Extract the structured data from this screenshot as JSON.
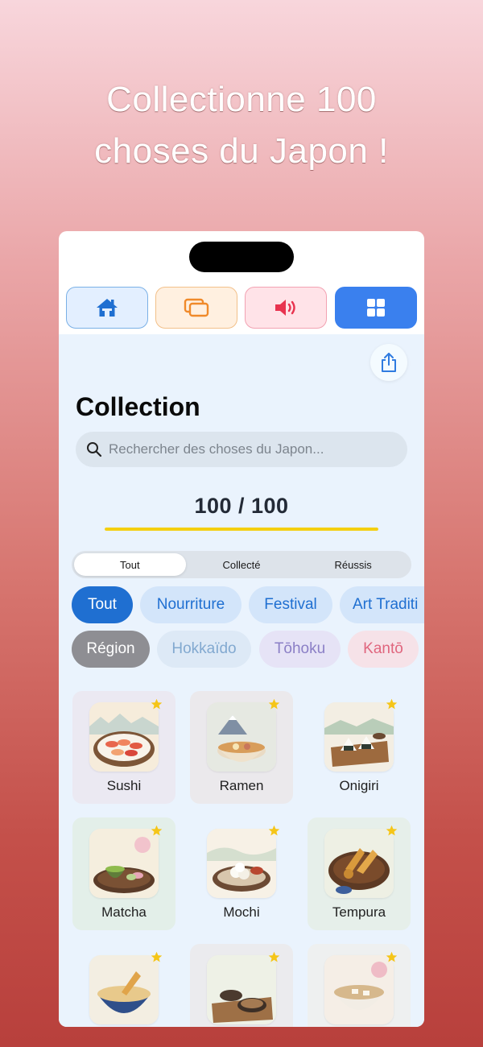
{
  "promo": {
    "line1": "Collectionne 100",
    "line2": "choses du Japon !"
  },
  "navbar": [
    {
      "icon": "home-icon",
      "color": "#1f6fd1"
    },
    {
      "icon": "cards-icon",
      "color": "#f08a2a"
    },
    {
      "icon": "speaker-icon",
      "color": "#e8334f"
    },
    {
      "icon": "grid-icon",
      "color": "#ffffff",
      "active": true
    }
  ],
  "page": {
    "title": "Collection",
    "search_placeholder": "Rechercher des choses du Japon...",
    "count": "100 / 100",
    "progress": 1.0
  },
  "segments": [
    "Tout",
    "Collecté",
    "Réussis"
  ],
  "segment_active": "Tout",
  "categories": [
    "Tout",
    "Nourriture",
    "Festival",
    "Art Traditi"
  ],
  "regions": [
    "Région",
    "Hokkaïdo",
    "Tōhoku",
    "Kantō"
  ],
  "items": [
    {
      "label": "Sushi",
      "starred": true
    },
    {
      "label": "Ramen",
      "starred": true
    },
    {
      "label": "Onigiri",
      "starred": true
    },
    {
      "label": "Matcha",
      "starred": true
    },
    {
      "label": "Mochi",
      "starred": true
    },
    {
      "label": "Tempura",
      "starred": true
    },
    {
      "label": "",
      "starred": true
    },
    {
      "label": "",
      "starred": true
    },
    {
      "label": "",
      "starred": true
    }
  ],
  "colors": {
    "accent": "#1f6fd1",
    "progress": "#f4cf10",
    "star": "#f5c518"
  }
}
